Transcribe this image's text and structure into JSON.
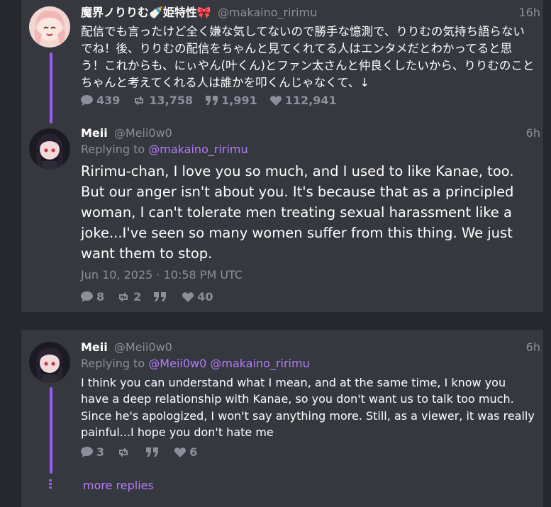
{
  "tweets": [
    {
      "name": "魔界ノりりむ🍼姫特性🎀",
      "handle": "@makaino_ririmu",
      "time": "16h",
      "text": "配信でも言ったけど全く嫌な気してないので勝手な憶測で、りりむの気持ち語らないでね！後、りりむの配信をちゃんと見てくれてる人はエンタメだとわかってると思う！これからも、にぃやん(叶くん)とファン太さんと仲良くしたいから、りりむのことちゃんと考えてくれる人は誰かを叩くんじゃなくて、↓",
      "replies": "439",
      "retweets": "13,758",
      "quotes": "1,991",
      "likes": "112,941"
    },
    {
      "name": "Meii",
      "handle": "@Meii0w0",
      "time": "6h",
      "replying_label": "Replying to",
      "replying_to": "@makaino_ririmu",
      "text": "Ririmu-chan, I love you so much, and I used to like Kanae, too. But our anger isn't about you. It's because that as a principled woman, I can't  tolerate men treating sexual harassment like a joke...I've seen so many women suffer from this thing. We just want them to stop.",
      "date": "Jun 10, 2025 · 10:58 PM UTC",
      "replies": "8",
      "retweets": "2",
      "quotes": "",
      "likes": "40"
    },
    {
      "name": "Meii",
      "handle": "@Meii0w0",
      "time": "6h",
      "replying_label": "Replying to",
      "replying_to_1": "@Meii0w0",
      "replying_to_2": "@makaino_ririmu",
      "text": "I think you can understand what I mean, and at the same time, I know you have a deep relationship with Kanae, so you don't want us to talk too much. Since he's apologized, I won't say anything more. Still, as a viewer, it was really painful...I hope you don't hate me",
      "replies": "3",
      "retweets": "",
      "quotes": "",
      "likes": "6"
    }
  ],
  "more_replies": "more replies",
  "colors": {
    "background": "#26272c",
    "card": "#363840",
    "accent": "#9b5cf5",
    "link": "#b57cf7",
    "muted": "#8c8e9a"
  },
  "icons": [
    "comment-icon",
    "retweet-icon",
    "quote-icon",
    "heart-icon"
  ]
}
